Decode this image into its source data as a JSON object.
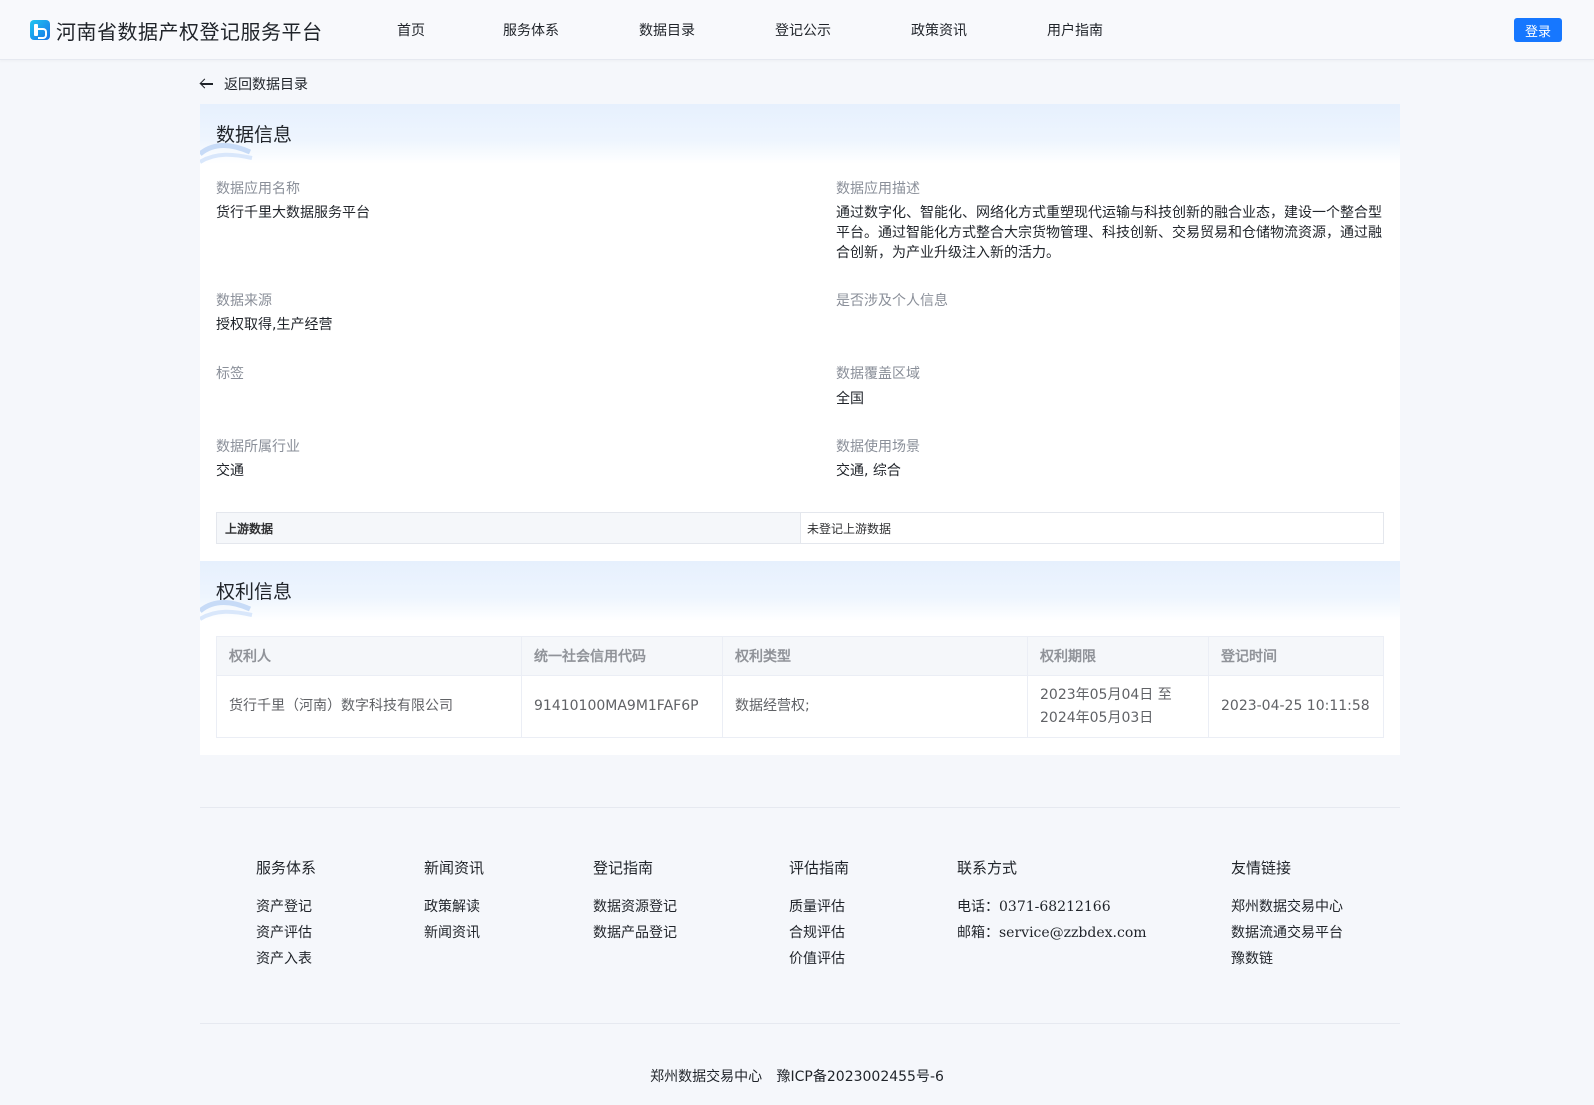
{
  "header": {
    "logo_text": "河南省数据产权登记服务平台",
    "nav": [
      "首页",
      "服务体系",
      "数据目录",
      "登记公示",
      "政策资讯",
      "用户指南"
    ],
    "login_label": "登录"
  },
  "back_label": "返回数据目录",
  "data_info": {
    "title": "数据信息",
    "app_name_label": "数据应用名称",
    "app_name": "货行千里大数据服务平台",
    "desc_label": "数据应用描述",
    "desc": "通过数字化、智能化、网络化方式重塑现代运输与科技创新的融合业态，建设一个整合型平台。通过智能化方式整合大宗货物管理、科技创新、交易贸易和仓储物流资源，通过融合创新，为产业升级注入新的活力。",
    "source_label": "数据来源",
    "source": "授权取得,生产经营",
    "personal_label": "是否涉及个人信息",
    "tag_label": "标签",
    "region_label": "数据覆盖区域",
    "region": "全国",
    "industry_label": "数据所属行业",
    "industry": "交通",
    "scene_label": "数据使用场景",
    "scene": "交通, 综合",
    "upstream_label": "上游数据",
    "upstream_value": "未登记上游数据"
  },
  "rights_info": {
    "title": "权利信息",
    "columns": [
      "权利人",
      "统一社会信用代码",
      "权利类型",
      "权利期限",
      "登记时间"
    ],
    "rows": [
      {
        "holder": "货行千里（河南）数字科技有限公司",
        "code": "91410100MA9M1FAF6P",
        "type": "数据经营权;",
        "period_start": "2023年05月04日 至",
        "period_end": "2024年05月03日",
        "time": "2023-04-25 10:11:58"
      }
    ]
  },
  "footer": {
    "service": {
      "title": "服务体系",
      "links": [
        "资产登记",
        "资产评估",
        "资产入表"
      ]
    },
    "news": {
      "title": "新闻资讯",
      "links": [
        "政策解读",
        "新闻资讯"
      ]
    },
    "register": {
      "title": "登记指南",
      "links": [
        "数据资源登记",
        "数据产品登记"
      ]
    },
    "eval": {
      "title": "评估指南",
      "links": [
        "质量评估",
        "合规评估",
        "价值评估"
      ]
    },
    "contact": {
      "title": "联系方式",
      "phone_label": "电话：",
      "phone": "0371-68212166",
      "email_label": "邮箱：",
      "email": "service@zzbdex.com"
    },
    "friends": {
      "title": "友情链接",
      "links": [
        "郑州数据交易中心",
        "数据流通交易平台",
        "豫数链"
      ]
    },
    "org": "郑州数据交易中心",
    "icp": "豫ICP备2023002455号-6"
  }
}
